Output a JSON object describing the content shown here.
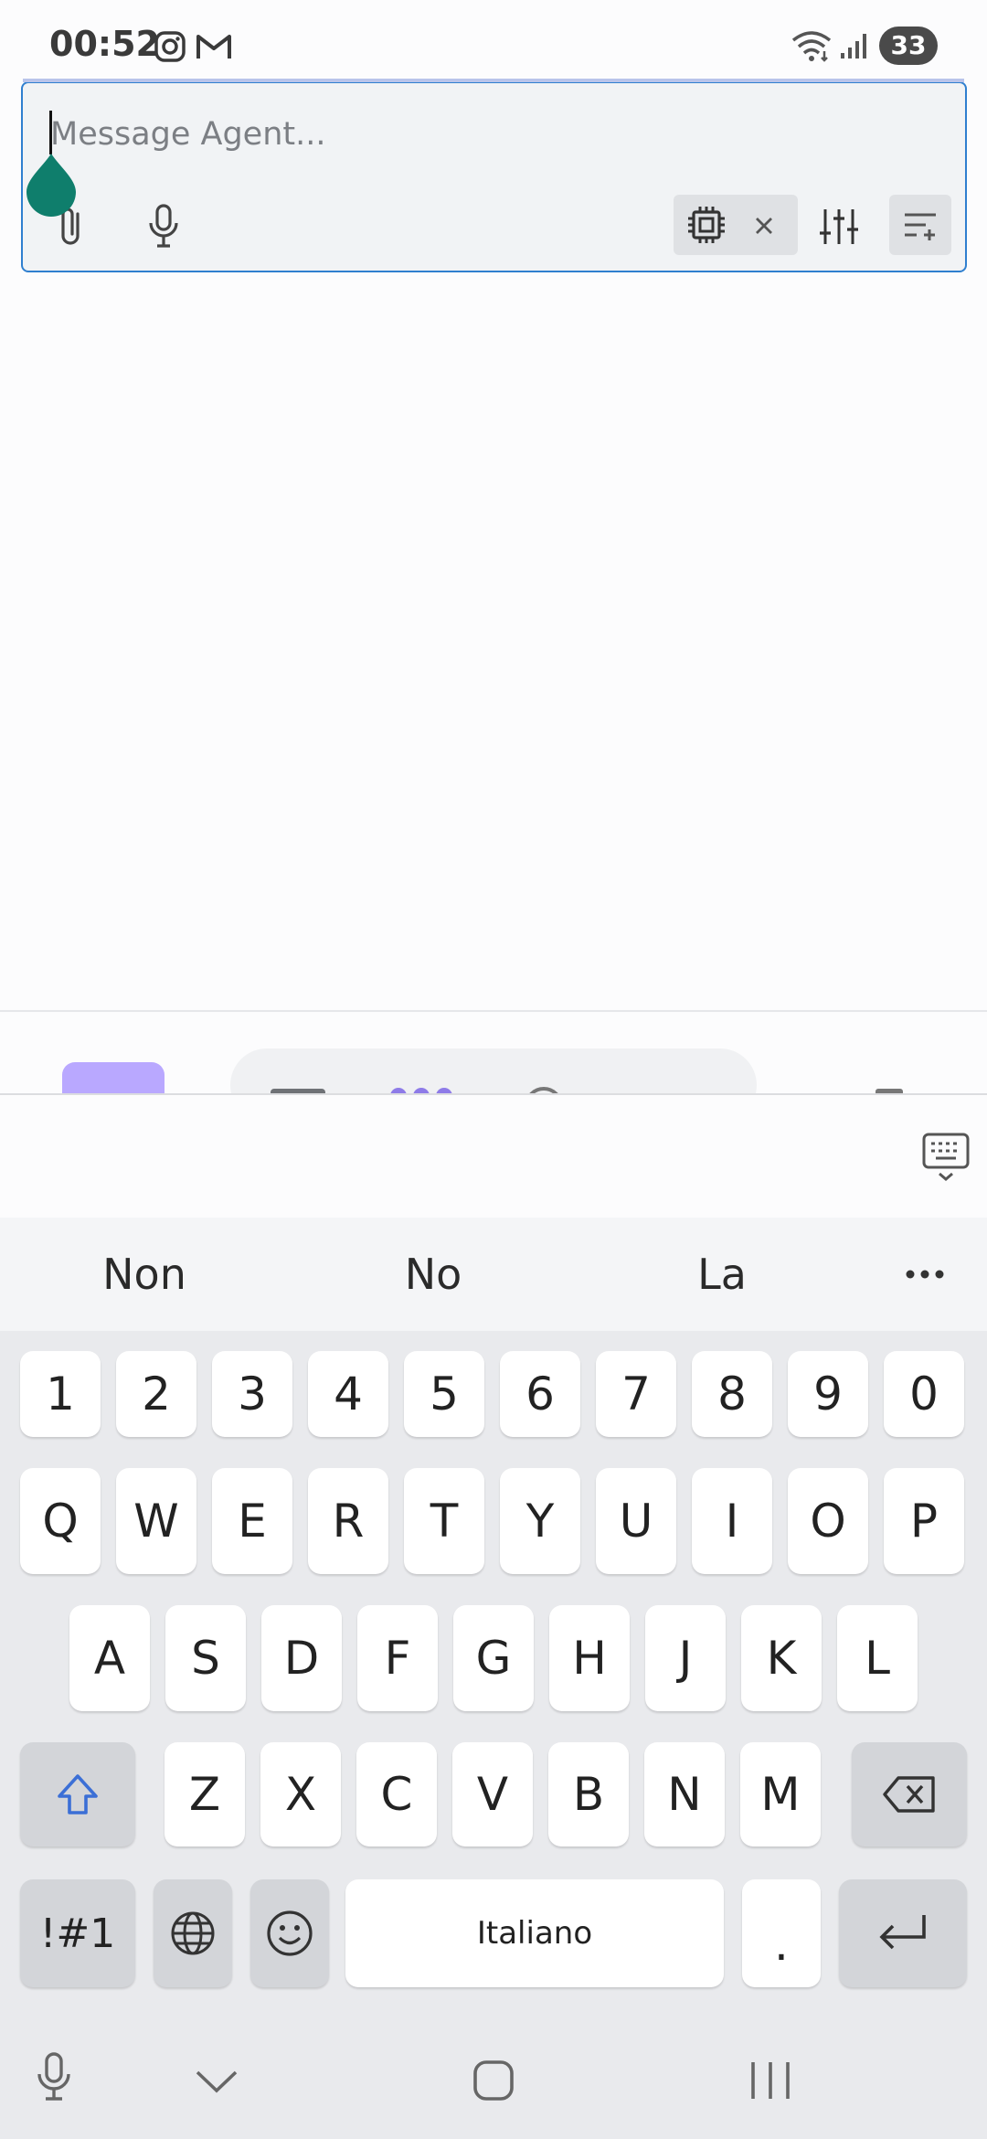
{
  "status": {
    "time": "00:52",
    "battery": "33",
    "notification_icons": [
      "instagram-icon",
      "gmail-icon"
    ],
    "system_icons": [
      "wifi-icon",
      "signal-icon"
    ]
  },
  "composer": {
    "placeholder": "Message Agent...",
    "value": "",
    "accent": "#2f7fcf",
    "handle_color": "#0f7e6c",
    "icons": [
      "attach-icon",
      "microphone-icon",
      "chip-icon",
      "close-icon",
      "sliders-icon",
      "options-icon"
    ]
  },
  "keyboard": {
    "language": "Italiano",
    "suggestions": [
      "Non",
      "No",
      "La"
    ],
    "number_row": [
      "1",
      "2",
      "3",
      "4",
      "5",
      "6",
      "7",
      "8",
      "9",
      "0"
    ],
    "row1": [
      "Q",
      "W",
      "E",
      "R",
      "T",
      "Y",
      "U",
      "I",
      "O",
      "P"
    ],
    "row2": [
      "A",
      "S",
      "D",
      "F",
      "G",
      "H",
      "J",
      "K",
      "L"
    ],
    "row3": [
      "Z",
      "X",
      "C",
      "V",
      "B",
      "N",
      "M"
    ],
    "symbols_label": "!#1",
    "period": ".",
    "shift_color": "#3b6fd6"
  },
  "colors": {
    "peek_accent": "#b9a8ff",
    "peek_dots": "#8e7be8"
  }
}
